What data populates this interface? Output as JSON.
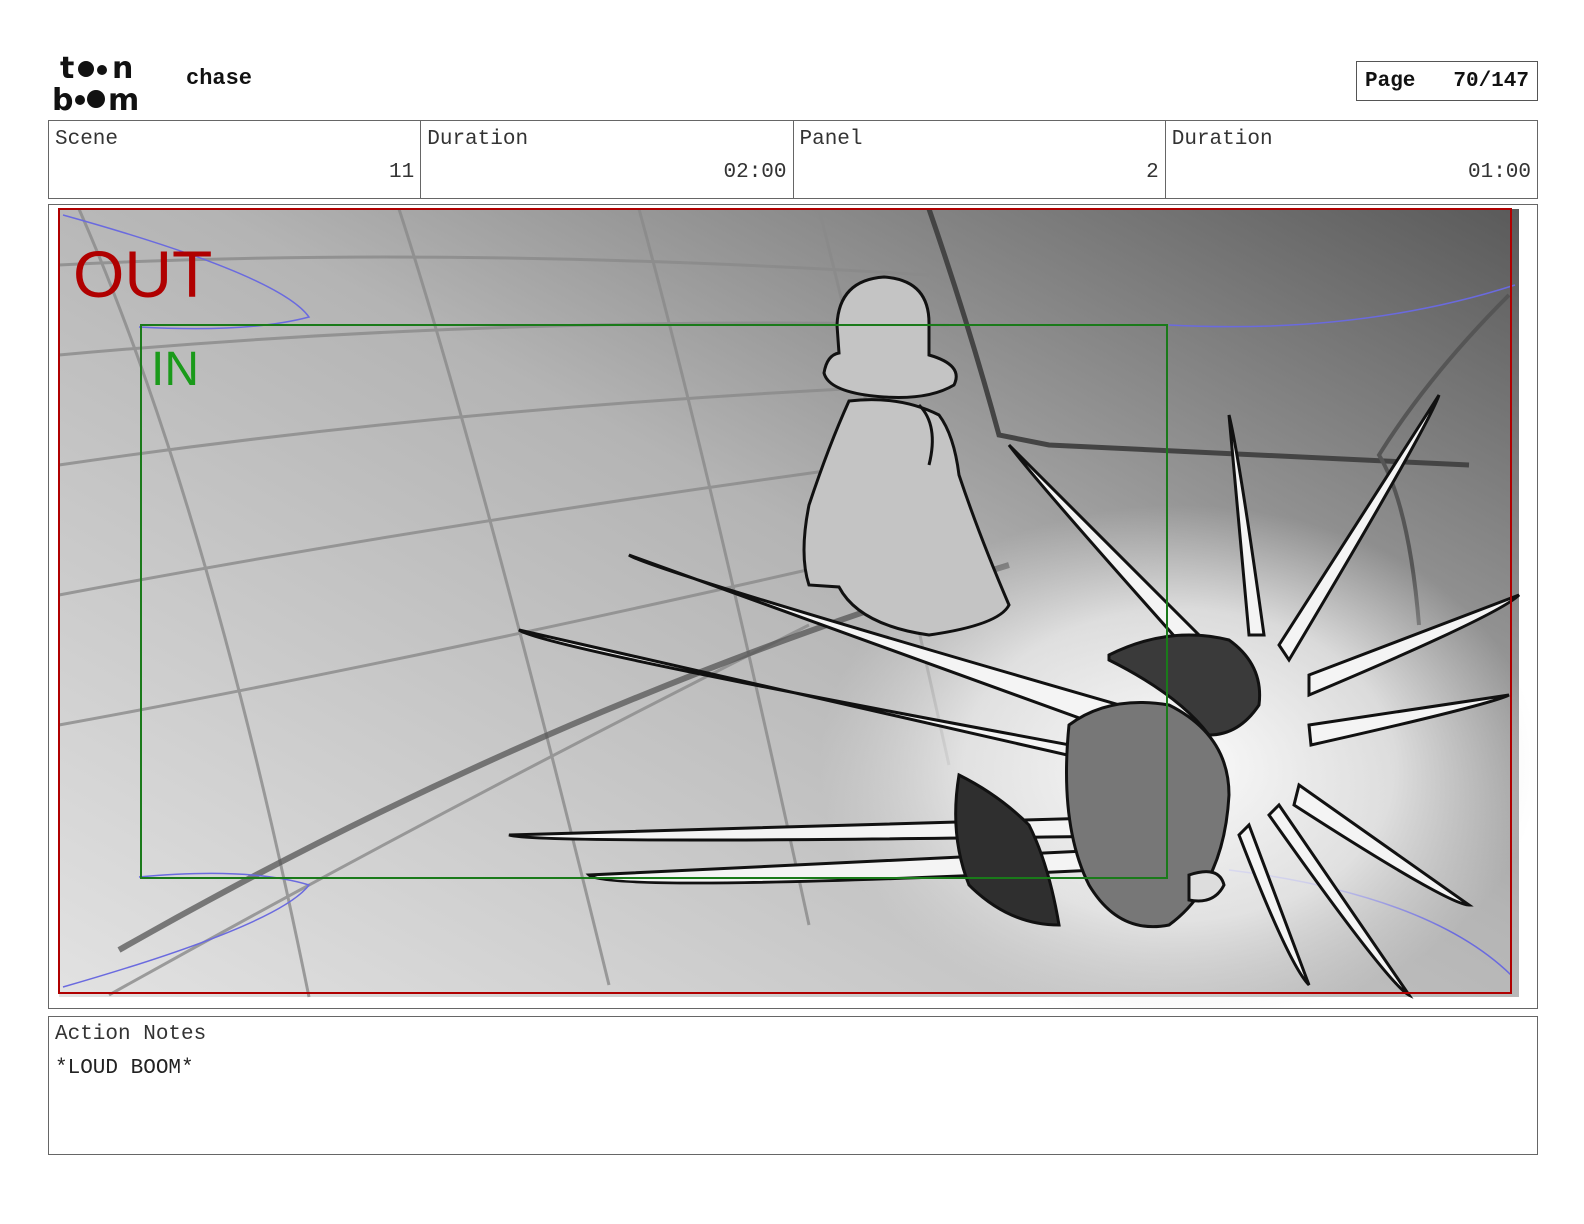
{
  "header": {
    "project_name": "chase",
    "page_label": "Page",
    "page_number": "70/147"
  },
  "info": {
    "scene_label": "Scene",
    "scene_value": "11",
    "scene_duration_label": "Duration",
    "scene_duration_value": "02:00",
    "panel_label": "Panel",
    "panel_value": "2",
    "panel_duration_label": "Duration",
    "panel_duration_value": "01:00"
  },
  "frame": {
    "out_label": "OUT",
    "in_label": "IN",
    "out_color": "#b00000",
    "in_color": "#1a9a1a"
  },
  "notes": {
    "label": "Action Notes",
    "text": "*LOUD BOOM*"
  }
}
